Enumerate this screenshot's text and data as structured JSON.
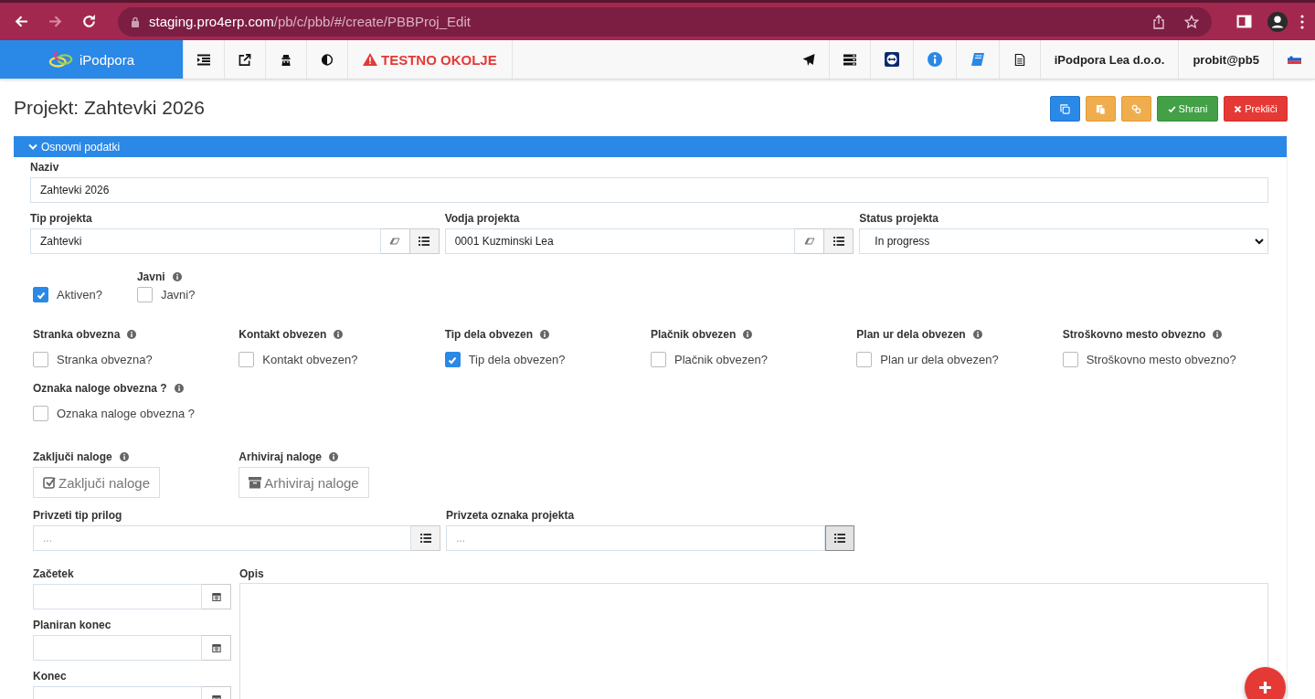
{
  "browser": {
    "url_host": "staging.pro4erp.com",
    "url_path": "/pb/c/pbb/#/create/PBBProj_Edit"
  },
  "navbar": {
    "brand": "iPodpora",
    "env_warning": "TESTNO OKOLJE",
    "company": "iPodpora Lea d.o.o.",
    "user": "probit@pb5"
  },
  "page": {
    "title": "Projekt: Zahtevki 2026",
    "actions": [
      {
        "kind": "copy"
      },
      {
        "kind": "paste"
      },
      {
        "kind": "link"
      },
      {
        "kind": "save",
        "label": "Shrani"
      },
      {
        "kind": "cancel",
        "label": "Prekliči"
      }
    ]
  },
  "section": {
    "title": "Osnovni podatki",
    "expanded": true
  },
  "naziv": {
    "label": "Naziv",
    "value": "Zahtevki 2026"
  },
  "lookups": [
    {
      "label": "Tip projekta",
      "value": "Zahtevki"
    },
    {
      "label": "Vodja projekta",
      "value": "0001 Kuzminski Lea"
    }
  ],
  "status": {
    "label": "Status projekta",
    "value": "In progress"
  },
  "aktiven": {
    "label": "Aktiven?",
    "checked": true
  },
  "javni": {
    "heading": "Javni",
    "label": "Javni?",
    "checked": false
  },
  "flags": [
    {
      "heading": "Stranka obvezna",
      "label": "Stranka obvezna?",
      "checked": false
    },
    {
      "heading": "Kontakt obvezen",
      "label": "Kontakt obvezen?",
      "checked": false
    },
    {
      "heading": "Tip dela obvezen",
      "label": "Tip dela obvezen?",
      "checked": true
    },
    {
      "heading": "Plačnik obvezen",
      "label": "Plačnik obvezen?",
      "checked": false
    },
    {
      "heading": "Plan ur dela obvezen",
      "label": "Plan ur dela obvezen?",
      "checked": false
    },
    {
      "heading": "Stroškovno mesto obvezno",
      "label": "Stroškovno mesto obvezno?",
      "checked": false
    },
    {
      "heading": "Oznaka naloge obvezna ?",
      "label": "Oznaka naloge obvezna ?",
      "checked": false
    }
  ],
  "task_actions": [
    {
      "kind": "close",
      "heading": "Zaključi naloge",
      "label": "Zaključi naloge"
    },
    {
      "kind": "archive",
      "heading": "Arhiviraj naloge",
      "label": "Arhiviraj naloge"
    }
  ],
  "pickers": [
    {
      "label": "Privzeti tip prilog",
      "placeholder": "...",
      "active": false
    },
    {
      "label": "Privzeta oznaka projekta",
      "placeholder": "...",
      "active": true
    }
  ],
  "dates": [
    {
      "label": "Začetek"
    },
    {
      "label": "Planiran konec"
    },
    {
      "label": "Konec"
    }
  ],
  "opis": {
    "label": "Opis"
  }
}
